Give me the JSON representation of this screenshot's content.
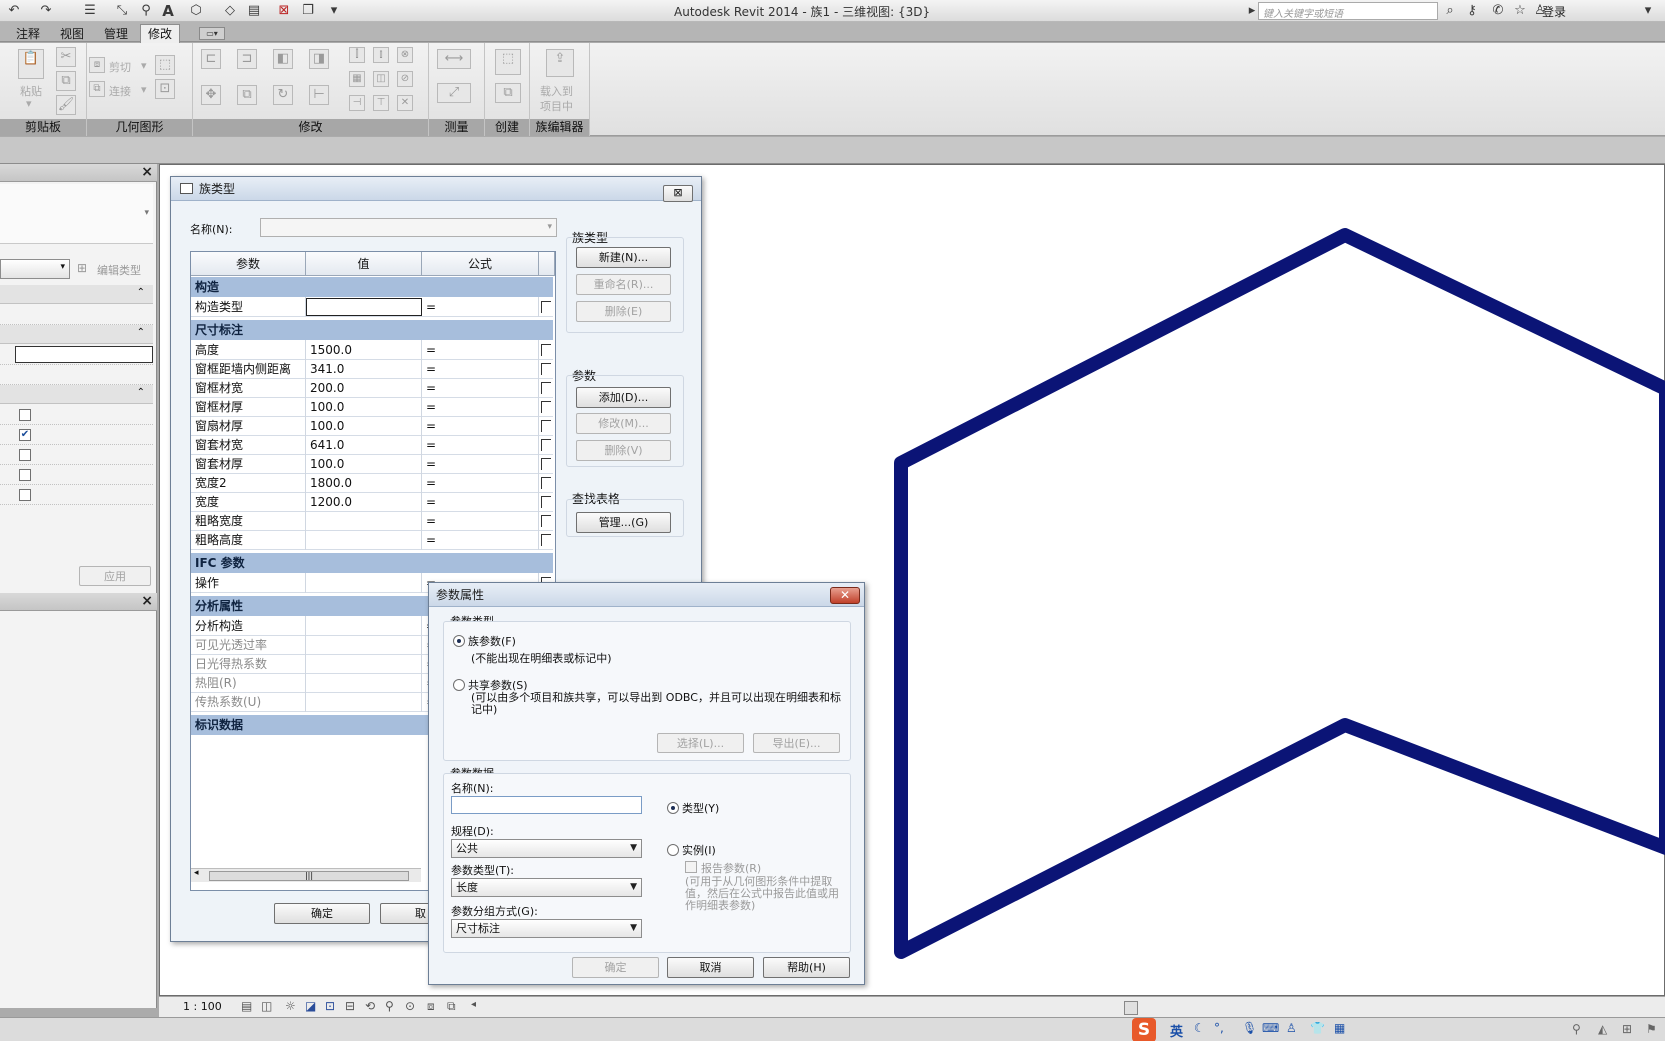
{
  "titlebar": {
    "app_title": "Autodesk Revit 2014 -   族1 - 三维视图: {3D}",
    "search_placeholder": "键入关键字或短语",
    "login": "登录"
  },
  "ribbon": {
    "tabs": [
      "注释",
      "视图",
      "管理"
    ],
    "active_tab": "修改",
    "groups": {
      "clipboard": "剪贴板",
      "geometry": "几何图形",
      "modify": "修改",
      "measure": "测量",
      "create": "创建",
      "family_editor": "族编辑器"
    },
    "paste": "粘贴",
    "cut": "剪切",
    "join": "连接",
    "load_into": "载入到",
    "project_mid": "项目中"
  },
  "properties": {
    "edit_type": "编辑类型",
    "apply": "应用"
  },
  "family_types_dialog": {
    "title": "族类型",
    "name_label": "名称(N):",
    "name_value": "",
    "columns": [
      "参数",
      "值",
      "公式"
    ],
    "sections": [
      {
        "title": "构造",
        "rows": [
          {
            "param": "构造类型",
            "value": "",
            "formula": "=",
            "disabled": false
          }
        ]
      },
      {
        "title": "尺寸标注",
        "rows": [
          {
            "param": "高度",
            "value": "1500.0",
            "formula": "=",
            "disabled": false
          },
          {
            "param": "窗框距墙内侧距离",
            "value": "341.0",
            "formula": "=",
            "disabled": false
          },
          {
            "param": "窗框材宽",
            "value": "200.0",
            "formula": "=",
            "disabled": false
          },
          {
            "param": "窗框材厚",
            "value": "100.0",
            "formula": "=",
            "disabled": false
          },
          {
            "param": "窗扇材厚",
            "value": "100.0",
            "formula": "=",
            "disabled": false
          },
          {
            "param": "窗套材宽",
            "value": "641.0",
            "formula": "=",
            "disabled": false
          },
          {
            "param": "窗套材厚",
            "value": "100.0",
            "formula": "=",
            "disabled": false
          },
          {
            "param": "宽度2",
            "value": "1800.0",
            "formula": "=",
            "disabled": false
          },
          {
            "param": "宽度",
            "value": "1200.0",
            "formula": "=",
            "disabled": false
          },
          {
            "param": "粗略宽度",
            "value": "",
            "formula": "=",
            "disabled": false
          },
          {
            "param": "粗略高度",
            "value": "",
            "formula": "=",
            "disabled": false
          }
        ]
      },
      {
        "title": "IFC 参数",
        "rows": [
          {
            "param": "操作",
            "value": "",
            "formula": "=",
            "disabled": false
          }
        ]
      },
      {
        "title": "分析属性",
        "rows": [
          {
            "param": "分析构造",
            "value": "",
            "formula": "=",
            "disabled": false
          },
          {
            "param": "可见光透过率",
            "value": "",
            "formula": "=",
            "disabled": true
          },
          {
            "param": "日光得热系数",
            "value": "",
            "formula": "=",
            "disabled": true
          },
          {
            "param": "热阻(R)",
            "value": "",
            "formula": "=",
            "disabled": true
          },
          {
            "param": "传热系数(U)",
            "value": "",
            "formula": "=",
            "disabled": true
          }
        ]
      },
      {
        "title": "标识数据",
        "rows": []
      }
    ],
    "side": {
      "family_types": "族类型",
      "new": "新建(N)...",
      "rename": "重命名(R)...",
      "delete": "删除(E)",
      "params": "参数",
      "add": "添加(D)...",
      "modify": "修改(M)...",
      "remove": "删除(V)",
      "lookup": "查找表格",
      "manage": "管理...(G)"
    },
    "ok": "确定",
    "cancel_partial": "取"
  },
  "param_props_dialog": {
    "title": "参数属性",
    "param_type_group": "参数类型",
    "family_param": "族参数(F)",
    "family_param_note": "(不能出现在明细表或标记中)",
    "shared_param": "共享参数(S)",
    "shared_param_note": "(可以由多个项目和族共享，可以导出到 ODBC，并且可以出现在明细表和标记中)",
    "select": "选择(L)...",
    "export": "导出(E)...",
    "param_data_group": "参数数据",
    "name_label": "名称(N):",
    "name_value": "",
    "discipline_label": "规程(D):",
    "discipline_value": "公共",
    "param_type_label": "参数类型(T):",
    "param_type_value": "长度",
    "group_label": "参数分组方式(G):",
    "group_value": "尺寸标注",
    "type_radio": "类型(Y)",
    "instance_radio": "实例(I)",
    "report_param": "报告参数(R)",
    "report_note": "(可用于从几何图形条件中提取值，然后在公式中报告此值或用作明细表参数)",
    "ok": "确定",
    "cancel": "取消",
    "help": "帮助(H)"
  },
  "viewbar": {
    "scale": "1 : 100"
  },
  "statusbar": {
    "ime_lang": "英"
  },
  "colors": {
    "model_line": "#0b1476",
    "section_header": "#a7bedc"
  }
}
